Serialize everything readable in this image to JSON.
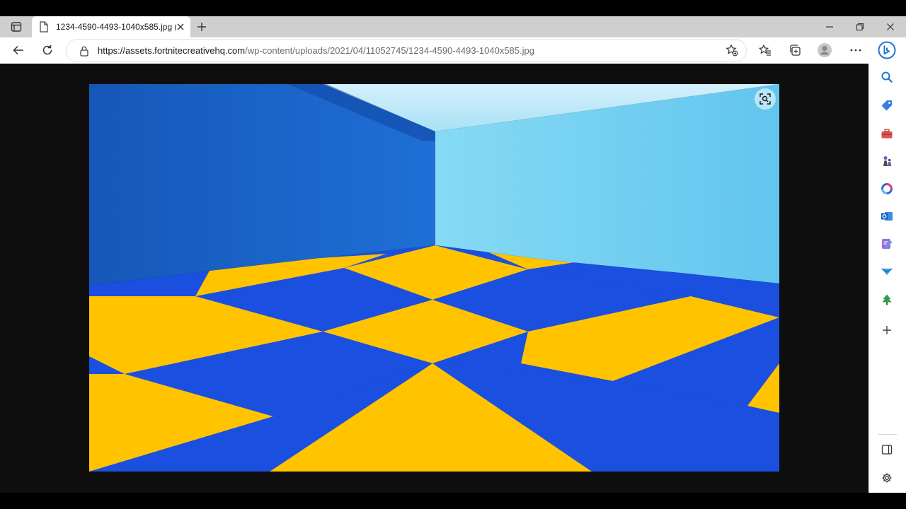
{
  "window": {
    "tab_title": "1234-4590-4493-1040x585.jpg (1",
    "url_host": "https://assets.fortnitecreativehq.com",
    "url_path": "/wp-content/uploads/2021/04/11052745/1234-4590-4493-1040x585.jpg"
  },
  "colors": {
    "checker_blue": "#1a4fe0",
    "checker_yellow": "#ffc300",
    "wall_left": "#1b63c9",
    "wall_right": "#7fd4f2"
  },
  "icons": {
    "tab_actions": "tab-actions-icon",
    "new_tab": "plus-icon",
    "back": "arrow-left-icon",
    "refresh": "refresh-icon",
    "lock": "lock-icon",
    "favorite": "star-add-icon",
    "favorites": "favorites-icon",
    "collections": "collections-icon",
    "profile": "profile-icon",
    "more": "ellipsis-icon",
    "copilot": "copilot-icon",
    "visual_search": "visual-search-icon"
  }
}
